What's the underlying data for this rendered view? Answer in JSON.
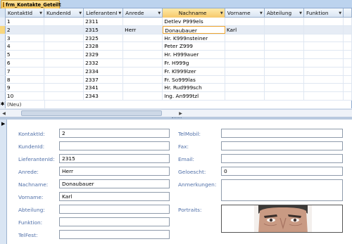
{
  "window": {
    "tab_title": "frm_Kontakte_Geteilt",
    "tab_icon": "form-icon"
  },
  "datasheet": {
    "columns": [
      "KontaktId",
      "KundenId",
      "LieferantenI",
      "Anrede",
      "Nachname",
      "Vorname",
      "Abteilung",
      "Funktion"
    ],
    "active_column": "Nachname",
    "rows": [
      [
        "1",
        "",
        "2311",
        "",
        "Detlev P999els",
        "",
        "",
        ""
      ],
      [
        "2",
        "",
        "2315",
        "Herr",
        "Donaubauer",
        "Karl",
        "",
        ""
      ],
      [
        "3",
        "",
        "2325",
        "",
        "Hr. K999nsteiner",
        "",
        "",
        ""
      ],
      [
        "4",
        "",
        "2328",
        "",
        "Peter Z999",
        "",
        "",
        ""
      ],
      [
        "5",
        "",
        "2329",
        "",
        "Hr. H999auer",
        "",
        "",
        ""
      ],
      [
        "6",
        "",
        "2332",
        "",
        "Fr. H999g",
        "",
        "",
        ""
      ],
      [
        "7",
        "",
        "2334",
        "",
        "Fr. Kl999lzer",
        "",
        "",
        ""
      ],
      [
        "8",
        "",
        "2337",
        "",
        "Fr. So999las",
        "",
        "",
        ""
      ],
      [
        "9",
        "",
        "2341",
        "",
        "Hr. Rud999sch",
        "",
        "",
        ""
      ],
      [
        "10",
        "",
        "2343",
        "",
        "Ing. An999tzl",
        "",
        "",
        ""
      ]
    ],
    "new_row_label": "(Neu)",
    "current_row": 1
  },
  "form": {
    "left": [
      {
        "label": "KontaktId:",
        "value": "2"
      },
      {
        "label": "KundenId:",
        "value": ""
      },
      {
        "label": "LieferantenId:",
        "value": "2315"
      },
      {
        "label": "Anrede:",
        "value": "Herr"
      },
      {
        "label": "Nachname:",
        "value": "Donaubauer"
      },
      {
        "label": "Vorname:",
        "value": "Karl"
      },
      {
        "label": "Abteilung:",
        "value": ""
      },
      {
        "label": "Funktion:",
        "value": ""
      },
      {
        "label": "TelFest:",
        "value": ""
      }
    ],
    "right": [
      {
        "label": "TelMobil:",
        "value": ""
      },
      {
        "label": "Fax:",
        "value": ""
      },
      {
        "label": "Email:",
        "value": ""
      },
      {
        "label": "Geloescht:",
        "value": "0"
      },
      {
        "label": "Anmerkungen:",
        "value": ""
      },
      {
        "label": "Portraits:",
        "value": ""
      }
    ]
  },
  "colors": {
    "label_blue": "#4f6fa8",
    "accent_orange": "#f7c96b",
    "header_blue": "#d9e5f3"
  }
}
